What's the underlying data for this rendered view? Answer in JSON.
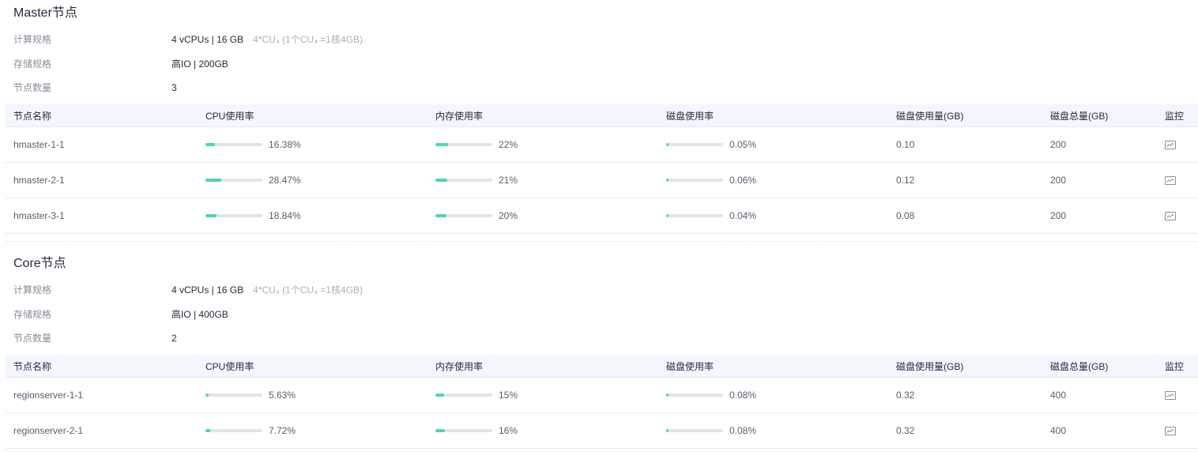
{
  "colors": {
    "bar_fill": "#50d4ab",
    "bar_track": "#e2e4e8",
    "header_bg": "#f3f6fd"
  },
  "columns": {
    "name": "节点名称",
    "cpu": "CPU使用率",
    "mem": "内存使用率",
    "disk": "磁盘使用率",
    "disk_used": "磁盘使用量(GB)",
    "disk_total": "磁盘总量(GB)",
    "monitor": "监控"
  },
  "master": {
    "title": "Master节点",
    "compute_label": "计算规格",
    "compute_value": "4 vCPUs | 16 GB",
    "compute_note": "4*CU₄ (1个CU₄ =1核4GB)",
    "storage_label": "存储规格",
    "storage_value": "高IO | 200GB",
    "count_label": "节点数量",
    "count_value": "3",
    "rows": [
      {
        "name": "hmaster-1-1",
        "cpu": 16.38,
        "cpu_text": "16.38%",
        "mem": 22,
        "mem_text": "22%",
        "disk": 0.05,
        "disk_text": "0.05%",
        "disk_used": "0.10",
        "disk_total": "200",
        "monitor_icon": "monitor-chart-icon"
      },
      {
        "name": "hmaster-2-1",
        "cpu": 28.47,
        "cpu_text": "28.47%",
        "mem": 21,
        "mem_text": "21%",
        "disk": 0.06,
        "disk_text": "0.06%",
        "disk_used": "0.12",
        "disk_total": "200",
        "monitor_icon": "monitor-chart-icon"
      },
      {
        "name": "hmaster-3-1",
        "cpu": 18.84,
        "cpu_text": "18.84%",
        "mem": 20,
        "mem_text": "20%",
        "disk": 0.04,
        "disk_text": "0.04%",
        "disk_used": "0.08",
        "disk_total": "200",
        "monitor_icon": "monitor-chart-icon"
      }
    ]
  },
  "core": {
    "title": "Core节点",
    "compute_label": "计算规格",
    "compute_value": "4 vCPUs | 16 GB",
    "compute_note": "4*CU₄ (1个CU₄ =1核4GB)",
    "storage_label": "存储规格",
    "storage_value": "高IO | 400GB",
    "count_label": "节点数量",
    "count_value": "2",
    "rows": [
      {
        "name": "regionserver-1-1",
        "cpu": 5.63,
        "cpu_text": "5.63%",
        "mem": 15,
        "mem_text": "15%",
        "disk": 0.08,
        "disk_text": "0.08%",
        "disk_used": "0.32",
        "disk_total": "400",
        "monitor_icon": "monitor-chart-icon"
      },
      {
        "name": "regionserver-2-1",
        "cpu": 7.72,
        "cpu_text": "7.72%",
        "mem": 16,
        "mem_text": "16%",
        "disk": 0.08,
        "disk_text": "0.08%",
        "disk_used": "0.32",
        "disk_total": "400",
        "monitor_icon": "monitor-chart-icon"
      }
    ]
  }
}
